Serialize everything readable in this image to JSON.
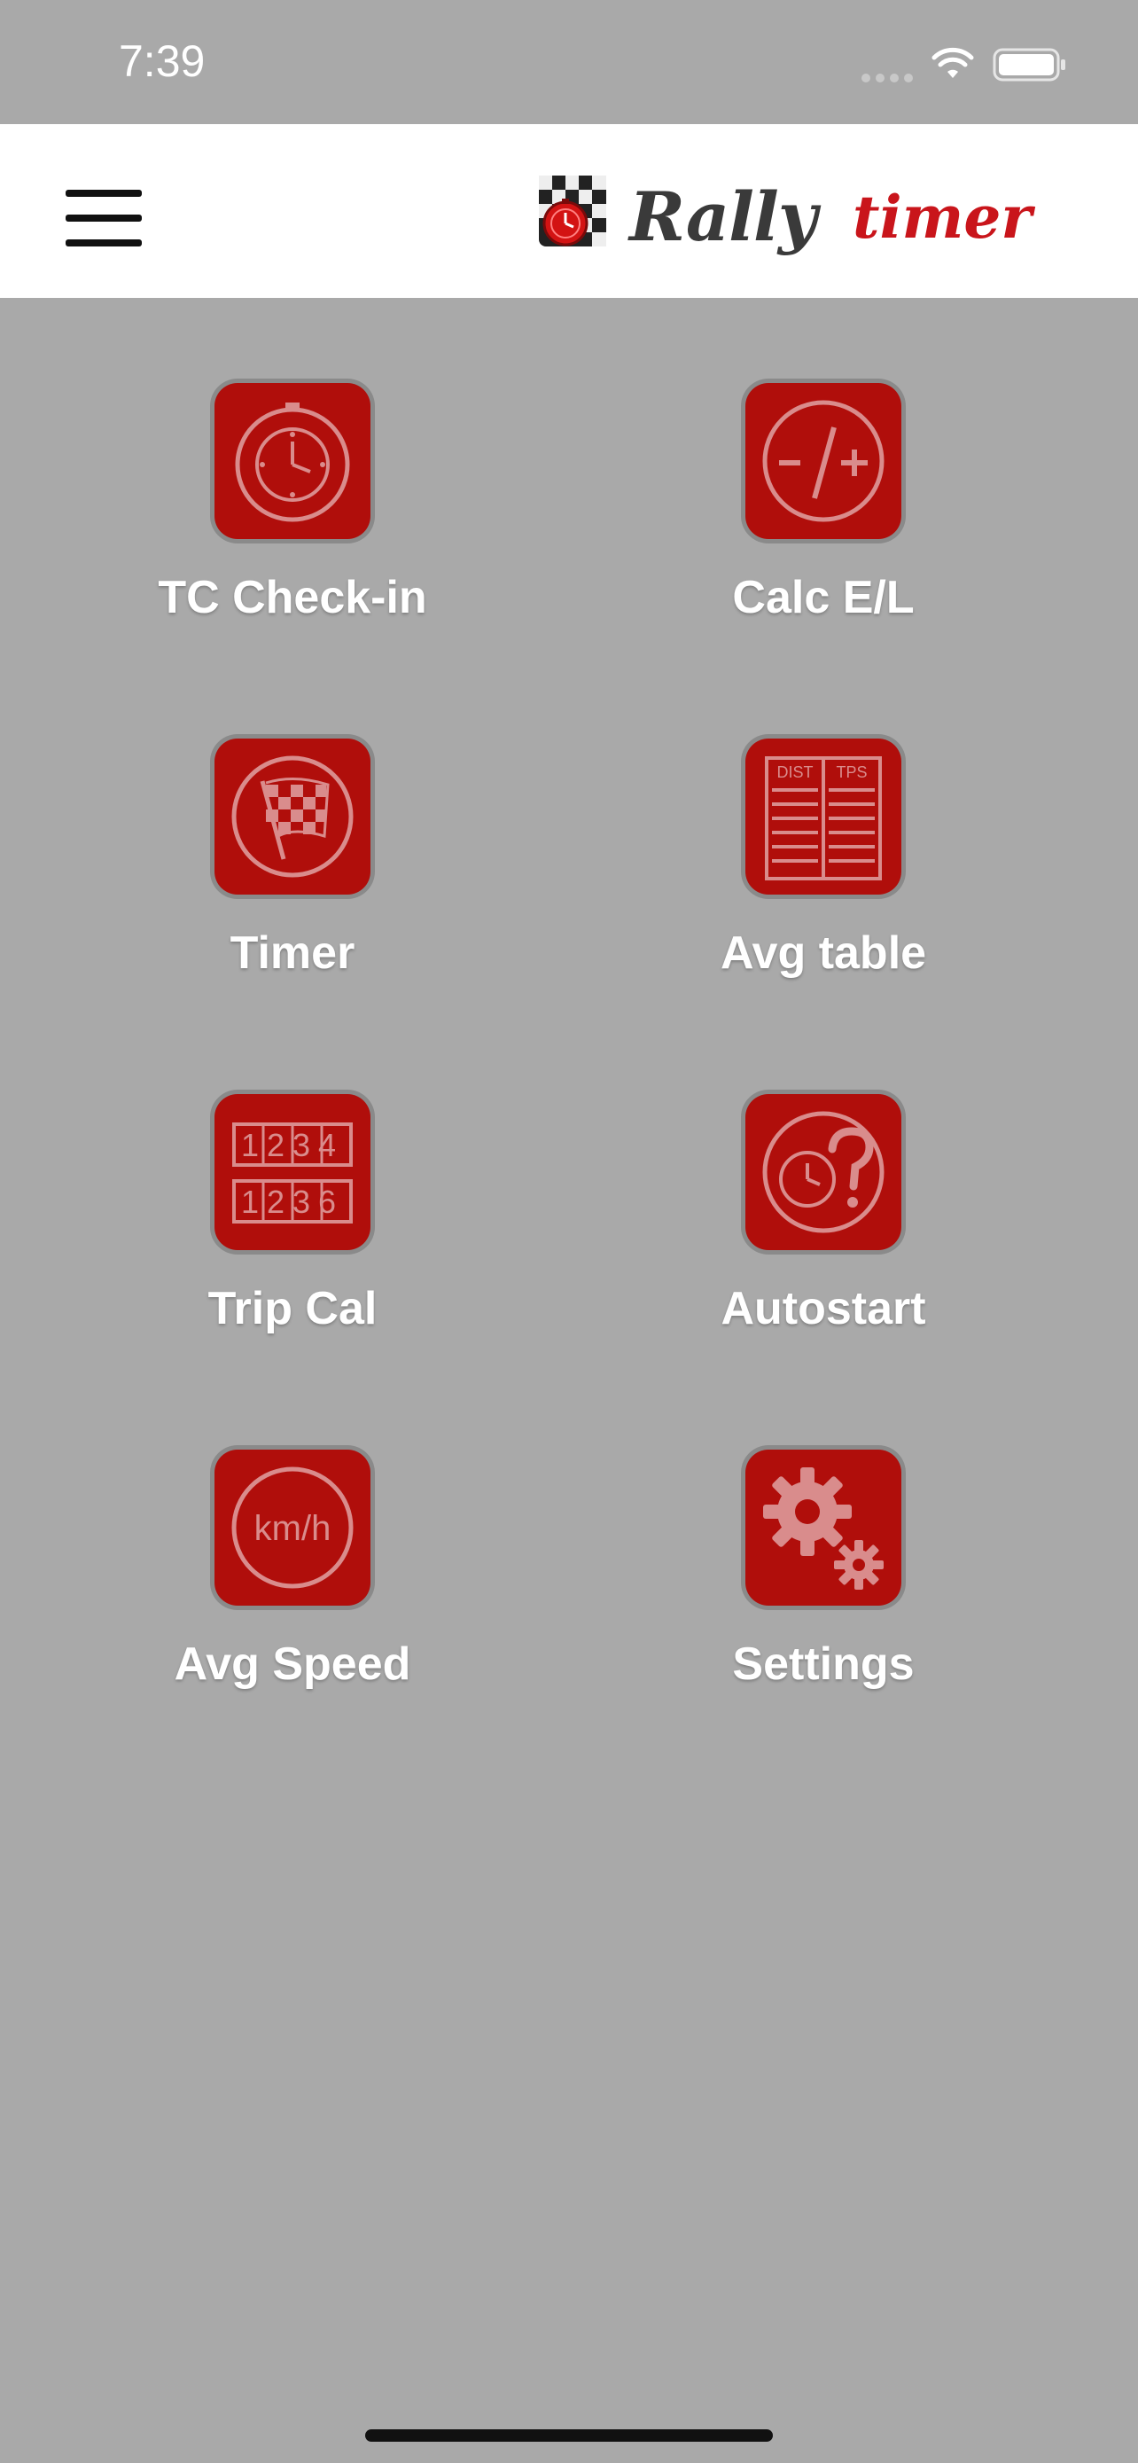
{
  "status_bar": {
    "time": "7:39"
  },
  "header": {
    "logo_word_1": "Rally",
    "logo_word_2": "timer"
  },
  "tiles": [
    {
      "label": "TC Check-in",
      "icon": "clock-icon"
    },
    {
      "label": "Calc E/L",
      "icon": "minus-plus-icon"
    },
    {
      "label": "Timer",
      "icon": "checkered-flag-icon"
    },
    {
      "label": "Avg table",
      "icon": "table-icon",
      "icon_text": [
        "DIST",
        "TPS"
      ]
    },
    {
      "label": "Trip Cal",
      "icon": "odometer-icon",
      "icon_text": [
        "1234",
        "1236"
      ]
    },
    {
      "label": "Autostart",
      "icon": "clock-question-icon"
    },
    {
      "label": "Avg Speed",
      "icon": "speed-icon",
      "icon_text": [
        "km/h"
      ]
    },
    {
      "label": "Settings",
      "icon": "gears-icon"
    }
  ],
  "colors": {
    "background": "#a9a9a9",
    "header_background": "#ffffff",
    "tile_red": "#b00e0b",
    "logo_red": "#c9151b"
  }
}
